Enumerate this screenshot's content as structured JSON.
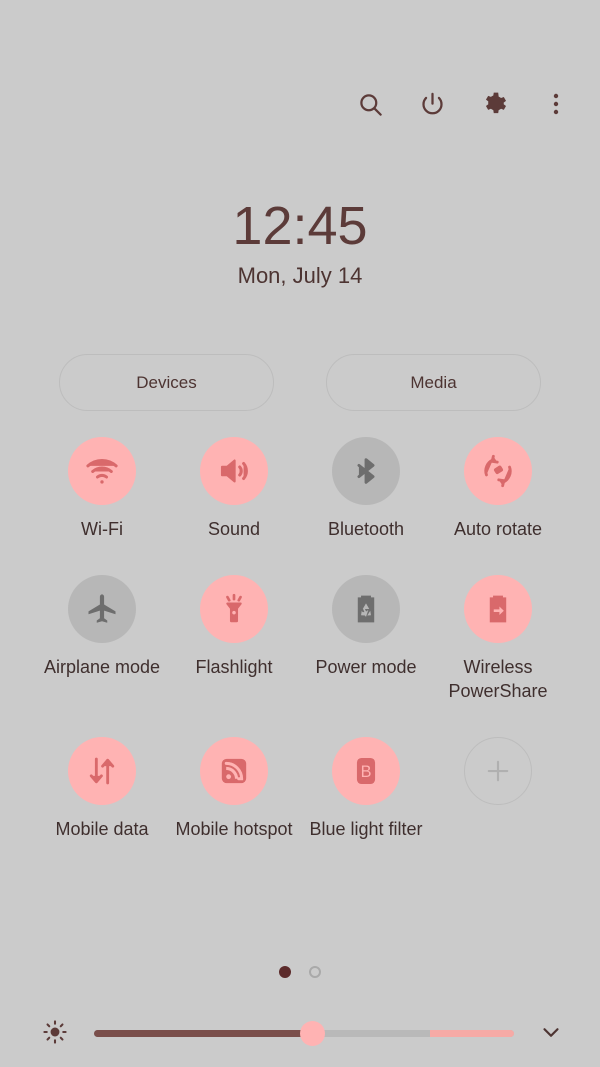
{
  "topbar": {
    "icons": [
      {
        "name": "search-icon",
        "label": "Search"
      },
      {
        "name": "power-icon",
        "label": "Power"
      },
      {
        "name": "gear-icon",
        "label": "Settings"
      },
      {
        "name": "more-vertical-icon",
        "label": "More options"
      }
    ]
  },
  "clock": {
    "time": "12:45",
    "date": "Mon, July 14"
  },
  "shortcuts": {
    "devices_label": "Devices",
    "media_label": "Media"
  },
  "toggles": [
    {
      "label": "Wi-Fi",
      "icon": "wifi-icon",
      "state": "on"
    },
    {
      "label": "Sound",
      "icon": "sound-icon",
      "state": "on"
    },
    {
      "label": "Bluetooth",
      "icon": "bluetooth-icon",
      "state": "off"
    },
    {
      "label": "Auto rotate",
      "icon": "auto-rotate-icon",
      "state": "on"
    },
    {
      "label": "Airplane mode",
      "icon": "airplane-icon",
      "state": "off"
    },
    {
      "label": "Flashlight",
      "icon": "flashlight-icon",
      "state": "on"
    },
    {
      "label": "Power mode",
      "icon": "power-mode-icon",
      "state": "off"
    },
    {
      "label": "Wireless PowerShare",
      "icon": "power-share-icon",
      "state": "on"
    },
    {
      "label": "Mobile data",
      "icon": "mobile-data-icon",
      "state": "on"
    },
    {
      "label": "Mobile hotspot",
      "icon": "mobile-hotspot-icon",
      "state": "on"
    },
    {
      "label": "Blue light filter",
      "icon": "blue-light-icon",
      "state": "on"
    },
    {
      "label": "",
      "icon": "add-icon",
      "state": "add"
    }
  ],
  "pagination": {
    "total": 2,
    "active_index": 0
  },
  "brightness": {
    "icon": "brightness-sun-icon",
    "value_percent": 52,
    "expand_icon": "chevron-down-icon"
  },
  "colors": {
    "background": "#cbcbcb",
    "accent_on_bubble": "#ffb3b3",
    "accent_on_icon": "#d9696b",
    "off_bubble": "#b7b7b7",
    "off_icon": "#6e6e6e",
    "text_dark": "#3f2f2e",
    "clock_text": "#5c3b39"
  }
}
